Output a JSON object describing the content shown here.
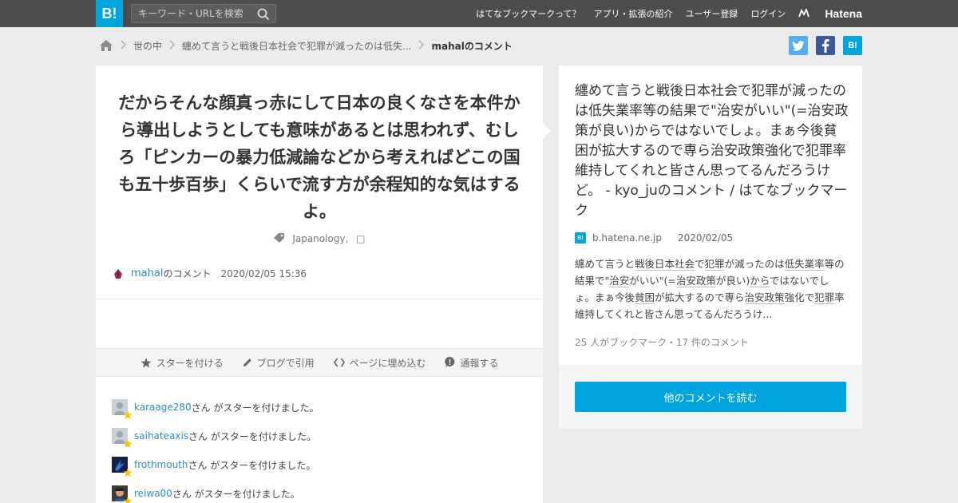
{
  "header": {
    "logo": "B!",
    "search_placeholder": "キーワード・URLを検索",
    "nav": [
      "はてなブックマークって？",
      "アプリ・拡張の紹介",
      "ユーザー登録",
      "ログイン"
    ],
    "hatena": "Hatena"
  },
  "breadcrumb": {
    "category": "世の中",
    "entry": "纏めて言うと戦後日本社会で犯罪が減ったのは低失...",
    "current": "mahalのコメント"
  },
  "comment": {
    "text": "だからそんな顔真っ赤にして日本の良くなさを本件から導出しようとしても意味があるとは思われず、むしろ「ピンカーの暴力低減論などから考えればどこの国も五十歩百歩」くらいで流す方が余程知的な気はするよ。",
    "tag": "Japanology,",
    "tag_extra": "□",
    "user": "mahal",
    "user_suffix": "のコメント",
    "date": "2020/02/05 15:36"
  },
  "actions": [
    {
      "label": "スターを付ける",
      "icon": "star-icon"
    },
    {
      "label": "ブログで引用",
      "icon": "pencil-icon"
    },
    {
      "label": "ページに埋め込む",
      "icon": "code-icon"
    },
    {
      "label": "通報する",
      "icon": "report-icon"
    }
  ],
  "stars": {
    "suffix": "さん がスターを付けました。",
    "users": [
      "karaage280",
      "saihateaxis",
      "frothmouth",
      "reiwa00"
    ]
  },
  "entry": {
    "title": "纏めて言うと戦後日本社会で犯罪が減ったのは低失業率等の結果で\"治安がいい\"(=治安政策が良い)からではないでしょ。まぁ今後貧困が拡大するので専ら治安政策強化で犯罪率維持してくれと皆さん思ってるんだろうけど。 - kyo_juのコメント / はてなブックマーク",
    "site": "b.hatena.ne.jp",
    "date": "2020/02/05",
    "summary_segments": [
      "纏めて言うと",
      "戦後日本社会",
      "で",
      "犯罪",
      "が減ったのは",
      "低失業率",
      "等の結果で\"",
      "治安",
      "がいい\"(=",
      "治安政策",
      "が良い)",
      "から",
      "ではないでしょ。まぁ今後",
      "貧困",
      "が拡大するので専ら",
      "治安政策",
      "強化で",
      "犯罪",
      "率維持してくれと皆さん思ってるんだろうけ..."
    ],
    "meta": "25 人がブックマーク・17 件のコメント",
    "read_button": "他のコメントを読む"
  },
  "colors": {
    "brand": "#00a4de",
    "header_bg": "#4d4d4d",
    "page_bg": "#ebebeb",
    "link": "#2a8fc4",
    "star": "#f5c400"
  }
}
